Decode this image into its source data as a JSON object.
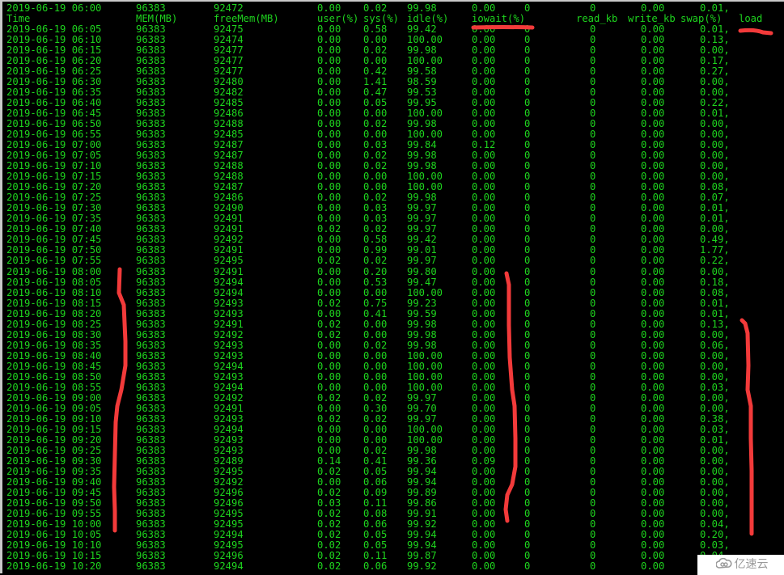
{
  "terminal": {
    "first_row": [
      "2019-06-19 06:00",
      "96383",
      "92472",
      "0.00",
      "0.02",
      "99.98",
      "0.00",
      "0",
      "0",
      "0.00",
      "0.01,"
    ],
    "headers": [
      "Time",
      "MEM(MB)",
      "freeMem(MB)",
      "user(%)",
      "sys(%)",
      "idle(%)",
      "iowait(%)",
      "read_kb",
      "write_kb",
      "swap(%)",
      "load"
    ],
    "rows": [
      [
        "2019-06-19 06:05",
        "96383",
        "92475",
        "0.00",
        "0.58",
        "99.42",
        "0.00",
        "0",
        "0",
        "0.00",
        "0.01,"
      ],
      [
        "2019-06-19 06:10",
        "96383",
        "92474",
        "0.00",
        "0.00",
        "100.00",
        "0.00",
        "0",
        "0",
        "0.00",
        "0.13,"
      ],
      [
        "2019-06-19 06:15",
        "96383",
        "92477",
        "0.00",
        "0.02",
        "99.98",
        "0.00",
        "0",
        "0",
        "0.00",
        "0.00,"
      ],
      [
        "2019-06-19 06:20",
        "96383",
        "92477",
        "0.00",
        "0.00",
        "100.00",
        "0.00",
        "0",
        "0",
        "0.00",
        "0.17,"
      ],
      [
        "2019-06-19 06:25",
        "96383",
        "92477",
        "0.00",
        "0.42",
        "99.58",
        "0.00",
        "0",
        "0",
        "0.00",
        "0.27,"
      ],
      [
        "2019-06-19 06:30",
        "96383",
        "92480",
        "0.00",
        "1.41",
        "98.59",
        "0.00",
        "0",
        "0",
        "0.00",
        "0.00,"
      ],
      [
        "2019-06-19 06:35",
        "96383",
        "92482",
        "0.00",
        "0.47",
        "99.53",
        "0.00",
        "0",
        "0",
        "0.00",
        "0.00,"
      ],
      [
        "2019-06-19 06:40",
        "96383",
        "92485",
        "0.00",
        "0.05",
        "99.95",
        "0.00",
        "0",
        "0",
        "0.00",
        "0.22,"
      ],
      [
        "2019-06-19 06:45",
        "96383",
        "92486",
        "0.00",
        "0.00",
        "100.00",
        "0.00",
        "0",
        "0",
        "0.00",
        "0.01,"
      ],
      [
        "2019-06-19 06:50",
        "96383",
        "92488",
        "0.00",
        "0.02",
        "99.98",
        "0.00",
        "0",
        "0",
        "0.00",
        "0.00,"
      ],
      [
        "2019-06-19 06:55",
        "96383",
        "92485",
        "0.00",
        "0.00",
        "100.00",
        "0.00",
        "0",
        "0",
        "0.00",
        "0.00,"
      ],
      [
        "2019-06-19 07:00",
        "96383",
        "92487",
        "0.00",
        "0.03",
        "99.84",
        "0.12",
        "0",
        "0",
        "0.00",
        "0.00,"
      ],
      [
        "2019-06-19 07:05",
        "96383",
        "92487",
        "0.00",
        "0.02",
        "99.98",
        "0.00",
        "0",
        "0",
        "0.00",
        "0.00,"
      ],
      [
        "2019-06-19 07:10",
        "96383",
        "92488",
        "0.00",
        "0.02",
        "99.98",
        "0.00",
        "0",
        "0",
        "0.00",
        "0.00,"
      ],
      [
        "2019-06-19 07:15",
        "96383",
        "92488",
        "0.00",
        "0.00",
        "100.00",
        "0.00",
        "0",
        "0",
        "0.00",
        "0.00,"
      ],
      [
        "2019-06-19 07:20",
        "96383",
        "92487",
        "0.00",
        "0.00",
        "100.00",
        "0.00",
        "0",
        "0",
        "0.00",
        "0.08,"
      ],
      [
        "2019-06-19 07:25",
        "96383",
        "92486",
        "0.00",
        "0.02",
        "99.98",
        "0.00",
        "0",
        "0",
        "0.00",
        "0.07,"
      ],
      [
        "2019-06-19 07:30",
        "96383",
        "92490",
        "0.00",
        "0.03",
        "99.97",
        "0.00",
        "0",
        "0",
        "0.00",
        "0.01,"
      ],
      [
        "2019-06-19 07:35",
        "96383",
        "92491",
        "0.00",
        "0.03",
        "99.97",
        "0.00",
        "0",
        "0",
        "0.00",
        "0.01,"
      ],
      [
        "2019-06-19 07:40",
        "96383",
        "92491",
        "0.02",
        "0.02",
        "99.97",
        "0.00",
        "0",
        "0",
        "0.00",
        "0.00,"
      ],
      [
        "2019-06-19 07:45",
        "96383",
        "92492",
        "0.00",
        "0.58",
        "99.42",
        "0.00",
        "0",
        "0",
        "0.00",
        "0.49,"
      ],
      [
        "2019-06-19 07:50",
        "96383",
        "92491",
        "0.00",
        "0.99",
        "99.01",
        "0.00",
        "0",
        "0",
        "0.00",
        "1.77,"
      ],
      [
        "2019-06-19 07:55",
        "96383",
        "92495",
        "0.02",
        "0.02",
        "99.97",
        "0.00",
        "0",
        "0",
        "0.00",
        "0.22,"
      ],
      [
        "2019-06-19 08:00",
        "96383",
        "92491",
        "0.00",
        "0.20",
        "99.80",
        "0.00",
        "0",
        "0",
        "0.00",
        "0.00,"
      ],
      [
        "2019-06-19 08:05",
        "96383",
        "92494",
        "0.00",
        "0.53",
        "99.47",
        "0.00",
        "0",
        "0",
        "0.00",
        "0.18,"
      ],
      [
        "2019-06-19 08:10",
        "96383",
        "92494",
        "0.00",
        "0.00",
        "100.00",
        "0.00",
        "0",
        "0",
        "0.00",
        "0.08,"
      ],
      [
        "2019-06-19 08:15",
        "96383",
        "92493",
        "0.02",
        "0.75",
        "99.23",
        "0.00",
        "0",
        "0",
        "0.00",
        "0.01,"
      ],
      [
        "2019-06-19 08:20",
        "96383",
        "92493",
        "0.00",
        "0.41",
        "99.59",
        "0.00",
        "0",
        "0",
        "0.00",
        "0.01,"
      ],
      [
        "2019-06-19 08:25",
        "96383",
        "92491",
        "0.02",
        "0.00",
        "99.98",
        "0.00",
        "0",
        "0",
        "0.00",
        "0.13,"
      ],
      [
        "2019-06-19 08:30",
        "96383",
        "92492",
        "0.02",
        "0.00",
        "99.98",
        "0.00",
        "0",
        "0",
        "0.00",
        "0.00,"
      ],
      [
        "2019-06-19 08:35",
        "96383",
        "92493",
        "0.00",
        "0.02",
        "99.98",
        "0.00",
        "0",
        "0",
        "0.00",
        "0.06,"
      ],
      [
        "2019-06-19 08:40",
        "96383",
        "92493",
        "0.00",
        "0.00",
        "100.00",
        "0.00",
        "0",
        "0",
        "0.00",
        "0.00,"
      ],
      [
        "2019-06-19 08:45",
        "96383",
        "92494",
        "0.00",
        "0.00",
        "100.00",
        "0.00",
        "0",
        "0",
        "0.00",
        "0.00,"
      ],
      [
        "2019-06-19 08:50",
        "96383",
        "92493",
        "0.00",
        "0.00",
        "100.00",
        "0.00",
        "0",
        "0",
        "0.00",
        "0.00,"
      ],
      [
        "2019-06-19 08:55",
        "96383",
        "92494",
        "0.00",
        "0.00",
        "100.00",
        "0.00",
        "0",
        "0",
        "0.00",
        "0.03,"
      ],
      [
        "2019-06-19 09:00",
        "96383",
        "92492",
        "0.02",
        "0.02",
        "99.97",
        "0.00",
        "0",
        "0",
        "0.00",
        "0.00,"
      ],
      [
        "2019-06-19 09:05",
        "96383",
        "92491",
        "0.00",
        "0.30",
        "99.70",
        "0.00",
        "0",
        "0",
        "0.00",
        "0.00,"
      ],
      [
        "2019-06-19 09:10",
        "96383",
        "92493",
        "0.02",
        "0.02",
        "99.97",
        "0.00",
        "0",
        "0",
        "0.00",
        "0.38,"
      ],
      [
        "2019-06-19 09:15",
        "96383",
        "92494",
        "0.00",
        "0.00",
        "100.00",
        "0.00",
        "0",
        "0",
        "0.00",
        "0.03,"
      ],
      [
        "2019-06-19 09:20",
        "96383",
        "92493",
        "0.00",
        "0.00",
        "100.00",
        "0.00",
        "0",
        "0",
        "0.00",
        "0.01,"
      ],
      [
        "2019-06-19 09:25",
        "96383",
        "92493",
        "0.00",
        "0.02",
        "99.98",
        "0.00",
        "0",
        "0",
        "0.00",
        "0.00,"
      ],
      [
        "2019-06-19 09:30",
        "96383",
        "92489",
        "0.14",
        "0.41",
        "99.36",
        "0.09",
        "0",
        "0",
        "0.00",
        "0.00,"
      ],
      [
        "2019-06-19 09:35",
        "96383",
        "92495",
        "0.02",
        "0.05",
        "99.94",
        "0.00",
        "0",
        "0",
        "0.00",
        "0.00,"
      ],
      [
        "2019-06-19 09:40",
        "96383",
        "92492",
        "0.00",
        "0.06",
        "99.94",
        "0.00",
        "0",
        "0",
        "0.00",
        "0.00,"
      ],
      [
        "2019-06-19 09:45",
        "96383",
        "92496",
        "0.02",
        "0.09",
        "99.89",
        "0.00",
        "0",
        "0",
        "0.00",
        "0.00,"
      ],
      [
        "2019-06-19 09:50",
        "96383",
        "92496",
        "0.03",
        "0.11",
        "99.86",
        "0.00",
        "0",
        "0",
        "0.00",
        "0.00,"
      ],
      [
        "2019-06-19 09:55",
        "96383",
        "92495",
        "0.02",
        "0.08",
        "99.91",
        "0.00",
        "0",
        "0",
        "0.00",
        "0.00,"
      ],
      [
        "2019-06-19 10:00",
        "96383",
        "92495",
        "0.02",
        "0.06",
        "99.92",
        "0.00",
        "0",
        "0",
        "0.00",
        "0.04,"
      ],
      [
        "2019-06-19 10:05",
        "96383",
        "92494",
        "0.02",
        "0.05",
        "99.94",
        "0.00",
        "0",
        "0",
        "0.00",
        "0.20,"
      ],
      [
        "2019-06-19 10:10",
        "96383",
        "92495",
        "0.02",
        "0.05",
        "99.94",
        "0.00",
        "0",
        "0",
        "0.00",
        "0.03,"
      ],
      [
        "2019-06-19 10:15",
        "96383",
        "92496",
        "0.02",
        "0.11",
        "99.87",
        "0.00",
        "0",
        "0",
        "0.00",
        "0.04,"
      ],
      [
        "2019-06-19 10:20",
        "96383",
        "92494",
        "0.02",
        "0.06",
        "99.92",
        "0.00",
        "0",
        "0",
        "0.00",
        ""
      ]
    ]
  },
  "colors": {
    "text": "#1ed41e",
    "background": "#000000",
    "annotation": "#f23a3a"
  },
  "watermark": {
    "icon": "cloud-icon",
    "text": "亿速云"
  }
}
